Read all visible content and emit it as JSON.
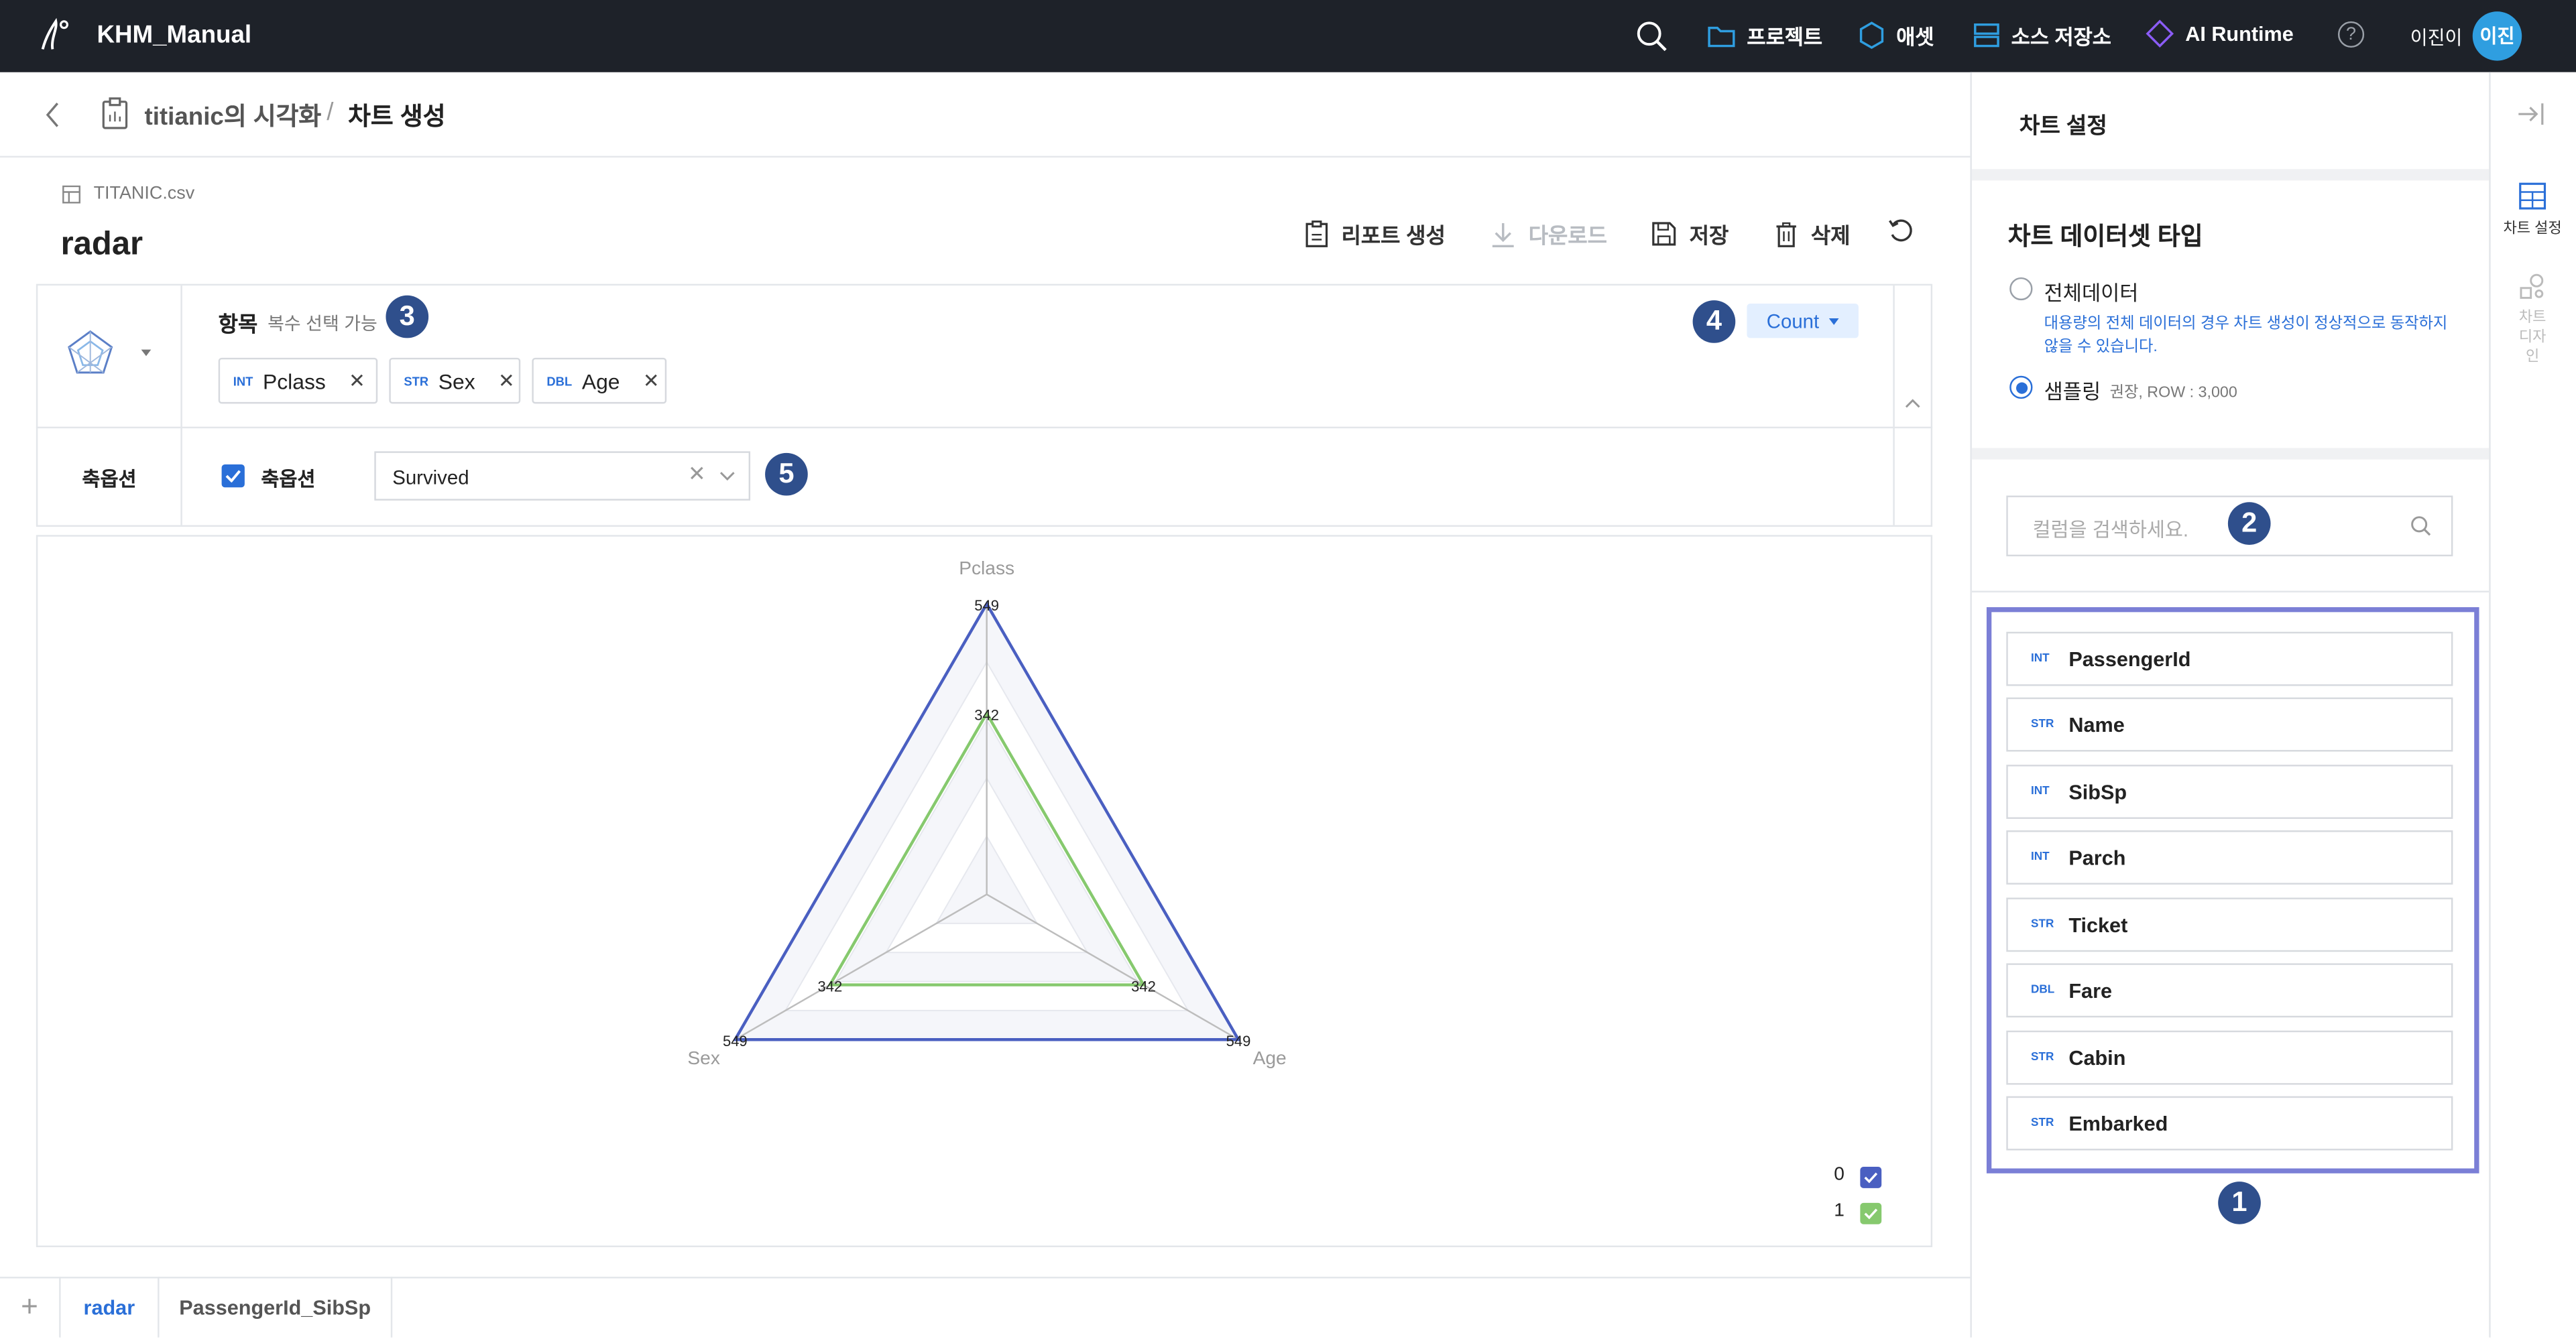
{
  "app": {
    "title": "KHM_Manual"
  },
  "nav": {
    "items": [
      {
        "label": "프로젝트",
        "color": "#2f9ee0"
      },
      {
        "label": "애셋",
        "color": "#2f9ee0"
      },
      {
        "label": "소스 저장소",
        "color": "#2f9ee0"
      },
      {
        "label": "AI Runtime",
        "color": "#8b5cf6"
      }
    ],
    "user_name": "이진이",
    "avatar_text": "이진"
  },
  "breadcrumb": {
    "parent": "titianic의 시각화",
    "separator": "/",
    "current": "차트 생성"
  },
  "file": {
    "name": "TITANIC.csv"
  },
  "chart_name": "radar",
  "toolbar": {
    "report": "리포트 생성",
    "download": "다운로드",
    "save": "저장",
    "delete": "삭제"
  },
  "config": {
    "items_label": "항목",
    "items_hint": "복수 선택 가능",
    "chips": [
      {
        "type": "INT",
        "name": "Pclass"
      },
      {
        "type": "STR",
        "name": "Sex"
      },
      {
        "type": "DBL",
        "name": "Age"
      }
    ],
    "aggregate": "Count",
    "axis_row_label": "축옵션",
    "axis_checkbox_label": "축옵션",
    "axis_value": "Survived"
  },
  "badges": {
    "b1": "1",
    "b2": "2",
    "b3": "3",
    "b4": "4",
    "b5": "5"
  },
  "chart_data": {
    "type": "radar",
    "axes": [
      "Pclass",
      "Age",
      "Sex"
    ],
    "series": [
      {
        "name": "0",
        "values": [
          549,
          549,
          549
        ],
        "color": "#4a5fc1"
      },
      {
        "name": "1",
        "values": [
          342,
          342,
          342
        ],
        "color": "#86c96e"
      }
    ],
    "max": 549,
    "legend_position": "bottom-right"
  },
  "tabs": [
    {
      "label": "radar",
      "active": true
    },
    {
      "label": "PassengerId_SibSp",
      "active": false
    }
  ],
  "settings": {
    "title": "차트 설정",
    "dataset_type_title": "차트 데이터셋 타입",
    "option_full": "전체데이터",
    "option_full_note": "대용량의 전체 데이터의 경우 차트 생성이 정상적으로 동작하지 않을 수 있습니다.",
    "option_sample": "샘플링",
    "option_sample_note": "권장, ROW : 3,000",
    "search_placeholder": "컬럼을 검색하세요.",
    "columns": [
      {
        "type": "INT",
        "name": "PassengerId"
      },
      {
        "type": "STR",
        "name": "Name"
      },
      {
        "type": "INT",
        "name": "SibSp"
      },
      {
        "type": "INT",
        "name": "Parch"
      },
      {
        "type": "STR",
        "name": "Ticket"
      },
      {
        "type": "DBL",
        "name": "Fare"
      },
      {
        "type": "STR",
        "name": "Cabin"
      },
      {
        "type": "STR",
        "name": "Embarked"
      }
    ]
  },
  "rail": {
    "settings": "차트 설정",
    "design": "차트 디자인"
  }
}
